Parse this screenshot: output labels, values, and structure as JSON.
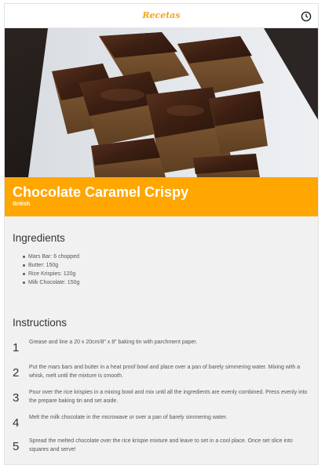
{
  "header": {
    "app_title": "Recetas",
    "clock_icon": "clock-icon"
  },
  "hero": {
    "image_subject": "chocolate-caramel-crispy-squares"
  },
  "recipe": {
    "title": "Chocolate Caramel Crispy",
    "area": "British",
    "accent_color": "#ffa600"
  },
  "ingredients": {
    "heading": "Ingredients",
    "items": [
      "Mars Bar: 6 chopped",
      "Butter: 150g",
      "Rice Krispies: 120g",
      "Milk Chocolate: 150g"
    ]
  },
  "instructions": {
    "heading": "Instructions",
    "steps": [
      {
        "num": "1",
        "text": "Grease and line a 20 x 20cm/8″ x 8″ baking tin with parchment paper."
      },
      {
        "num": "2",
        "text": "Put the mars bars and butter in a heat proof bowl and place over a pan of barely simmering water. Mixing with a whisk, melt until the mixture is smooth."
      },
      {
        "num": "3",
        "text": "Pour over the rice krispies in a mixing bowl and mix until all the ingredients are evenly combined. Press evenly into the prepare baking tin and set aside."
      },
      {
        "num": "4",
        "text": "Melt the milk chocolate in the microwave or over a pan of barely simmering water."
      },
      {
        "num": "5",
        "text": "Spread the melted chocolate over the rice krispie mixture and leave to set in a cool place. Once set slice into squares and serve!"
      }
    ]
  }
}
